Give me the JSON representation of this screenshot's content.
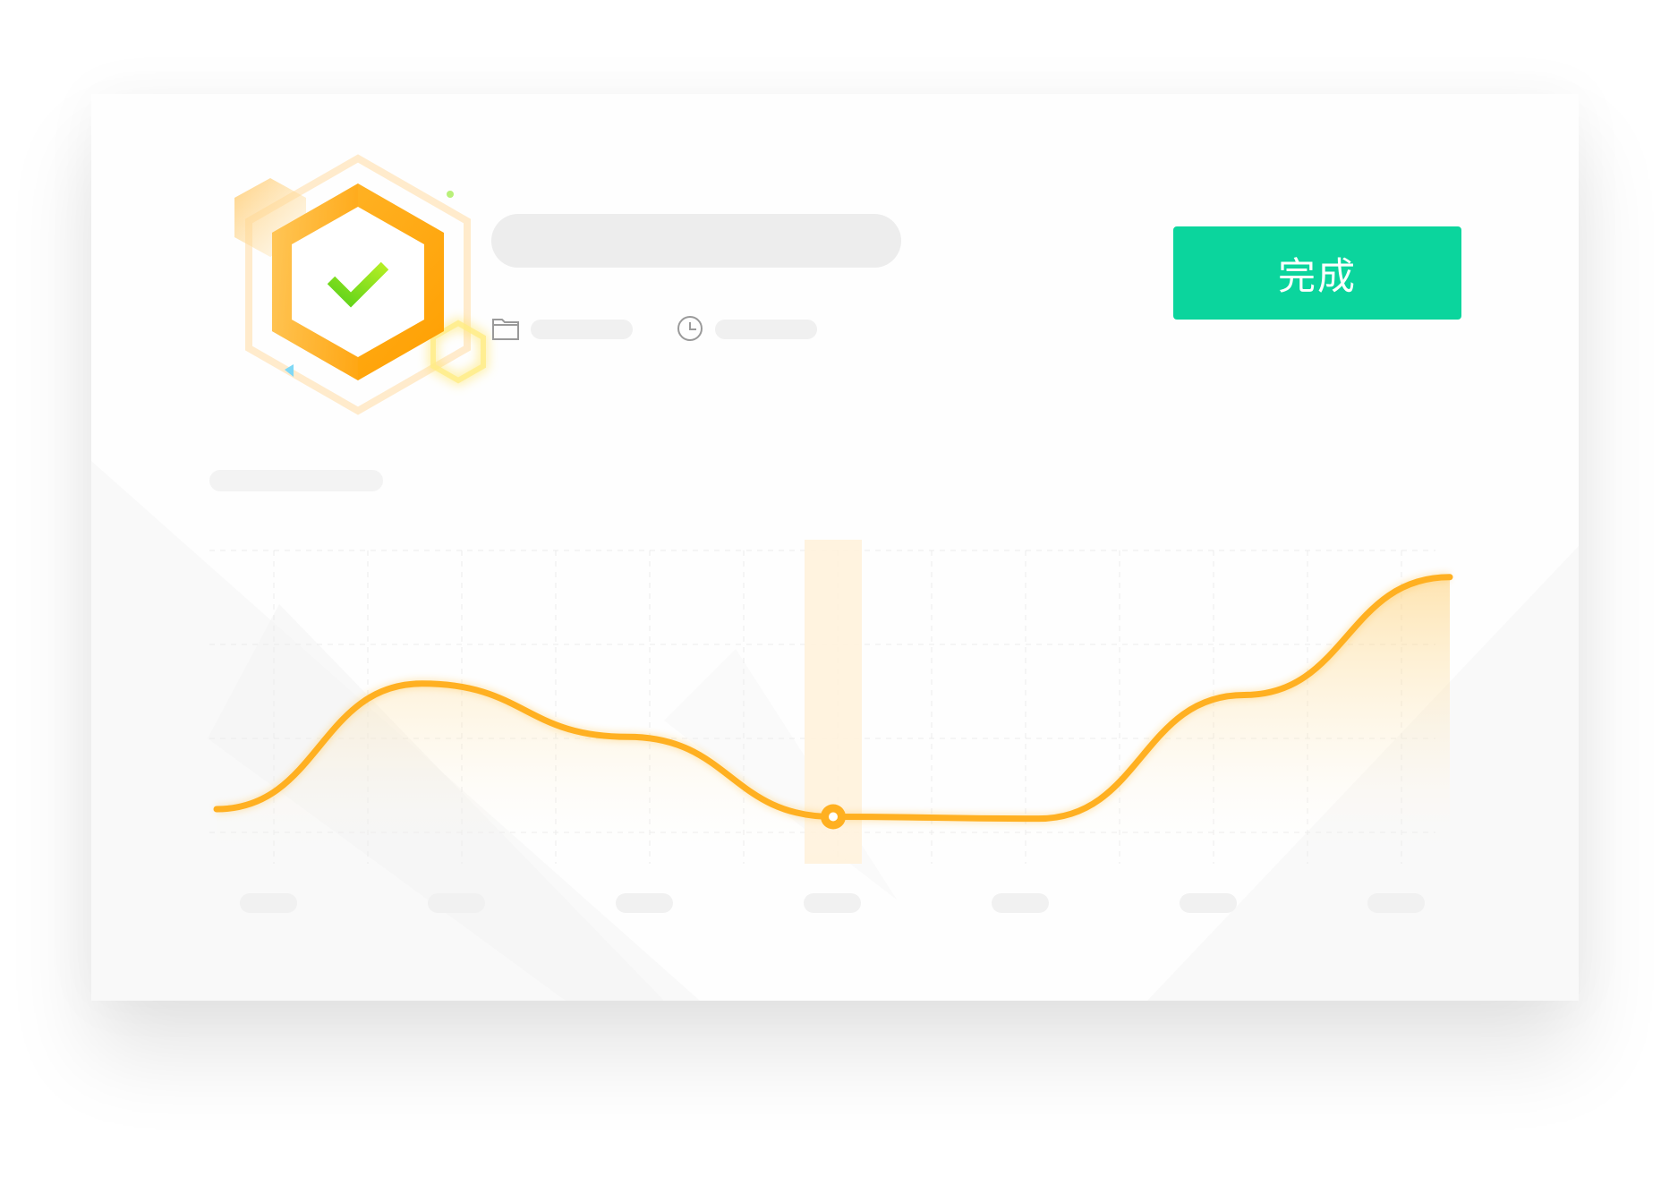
{
  "header": {
    "done_label": "完成"
  },
  "icons": {
    "badge": "hexagon-check-icon",
    "folder": "folder-icon",
    "clock": "clock-icon"
  },
  "colors": {
    "accent": "#ffb021",
    "button": "#0bd59d",
    "check": "#7ee31a",
    "highlight_band": "#fff1d9",
    "skeleton": "#ededed"
  },
  "chart_data": {
    "type": "area",
    "x": [
      0,
      1,
      2,
      3,
      4,
      5,
      6
    ],
    "values": [
      1.2,
      4.5,
      3.1,
      1.0,
      0.95,
      4.2,
      7.3
    ],
    "ylim": [
      0,
      8
    ],
    "highlight_index": 3,
    "grid": true,
    "x_tick_count": 7
  }
}
